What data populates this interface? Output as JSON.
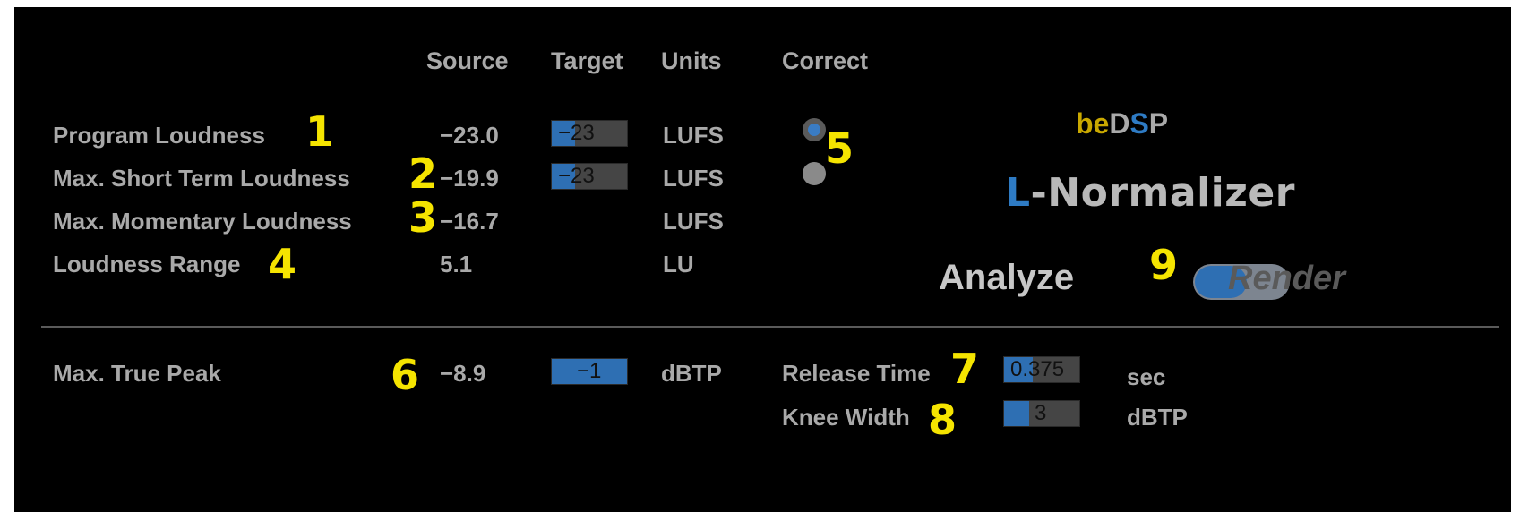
{
  "columns": {
    "source": "Source",
    "target": "Target",
    "units": "Units",
    "correct": "Correct"
  },
  "rows": [
    {
      "label": "Program Loudness",
      "marker": "1",
      "source": "−23.0",
      "target": "−23",
      "unit": "LUFS"
    },
    {
      "label": "Max. Short Term Loudness",
      "marker": "2",
      "source": "−19.9",
      "target": "−23",
      "unit": "LUFS"
    },
    {
      "label": "Max. Momentary Loudness",
      "marker": "3",
      "source": "−16.7",
      "unit": "LUFS"
    },
    {
      "label": "Loudness Range",
      "marker": "4",
      "source": "5.1",
      "unit": "LU"
    }
  ],
  "correct_marker": "5",
  "correct_options": [
    {
      "name": "program-loudness",
      "selected": true
    },
    {
      "name": "max-short-term-loudness",
      "selected": false
    }
  ],
  "brand": {
    "be": "be",
    "d": "D",
    "s": "S",
    "p": "P"
  },
  "product": {
    "first": "L",
    "rest": "-Normalizer"
  },
  "mode": {
    "analyze": "Analyze",
    "render": "Render",
    "marker": "9",
    "state": "analyze"
  },
  "peak": {
    "label": "Max. True Peak",
    "marker": "6",
    "source": "−8.9",
    "target": "−1",
    "unit": "dBTP"
  },
  "release": {
    "label": "Release Time",
    "marker": "7",
    "value": "0.375",
    "unit": "sec"
  },
  "knee": {
    "label": "Knee Width",
    "marker": "8",
    "value": "3",
    "unit": "dBTP"
  },
  "colors": {
    "background": "#000000",
    "text": "#a9a9a9",
    "accent_blue": "#2e6fb3",
    "marker_yellow": "#f5e400",
    "brand_gold": "#c9a800"
  }
}
